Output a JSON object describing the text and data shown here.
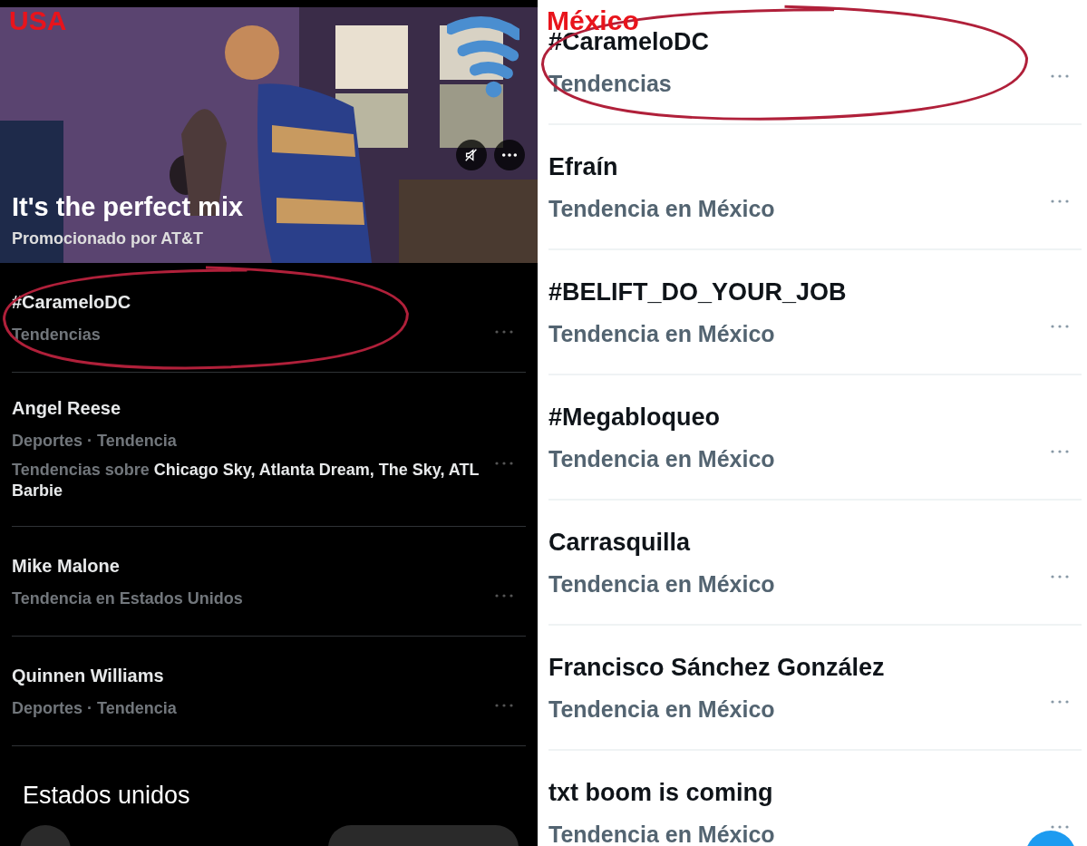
{
  "panels": [
    {
      "label": "USA",
      "kind": "dark",
      "promo": {
        "kind": "picture",
        "title": "It's the perfect mix",
        "sponsor": "Promocionado por AT&T"
      },
      "trends": [
        {
          "title": "#CarameloDC",
          "meta": "Tendencias",
          "circled": true
        },
        {
          "title": "Angel Reese",
          "meta": "Deportes · Tendencia",
          "related": "Tendencias sobre **Chicago Sky, Atlanta Dream, The Sky, ATL Barbie**",
          "circled": false
        },
        {
          "title": "Mike Malone",
          "meta": "Tendencia en Estados Unidos",
          "circled": false
        },
        {
          "title": "Quinnen Williams",
          "meta": "Deportes · Tendencia",
          "circled": false
        }
      ],
      "caption": "Estados unidos"
    },
    {
      "label": "México",
      "kind": "light",
      "trends": [
        {
          "title": "#CarameloDC",
          "meta": "Tendencias",
          "circled": true
        },
        {
          "title": "Efraín",
          "meta": "Tendencia en México",
          "circled": false
        },
        {
          "title": "#BELIFT_DO_YOUR_JOB",
          "meta": "Tendencia en México",
          "circled": false
        },
        {
          "title": "#Megabloqueo",
          "meta": "Tendencia en México",
          "circled": false
        },
        {
          "title": "Carrasquilla",
          "meta": "Tendencia en México",
          "circled": false
        },
        {
          "title": "Francisco Sánchez González",
          "meta": "Tendencia en México",
          "circled": false
        },
        {
          "title": "txt boom is coming",
          "meta": "Tendencia en México",
          "circled": false
        }
      ]
    }
  ]
}
